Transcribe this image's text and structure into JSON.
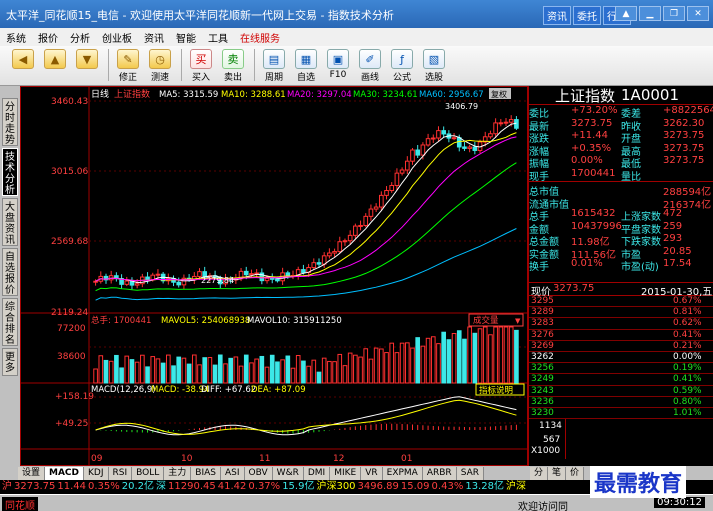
{
  "titlebar": {
    "title": "太平洋_同花顺15_电信 - 欢迎使用太平洋同花顺新一代网上交易 - 指数技术分析",
    "links": [
      "资讯",
      "委托",
      "行情"
    ],
    "win_buttons": [
      "▲",
      "▁",
      "❐",
      "✕"
    ]
  },
  "menubar": {
    "items": [
      "系统",
      "报价",
      "分析",
      "创业板",
      "资讯",
      "智能",
      "工具",
      "在线服务"
    ]
  },
  "toolbar": {
    "buttons": [
      {
        "label": "",
        "icon": "arrow-left-icon"
      },
      {
        "label": "",
        "icon": "arrow-up-icon"
      },
      {
        "label": "",
        "icon": "arrow-down-icon"
      },
      {
        "label": "修正",
        "icon": "edit-icon"
      },
      {
        "label": "测速",
        "icon": "speed-icon"
      },
      {
        "label": "买入",
        "icon": "buy-icon",
        "glyph": "买"
      },
      {
        "label": "卖出",
        "icon": "sell-icon",
        "glyph": "卖"
      },
      {
        "label": "周期",
        "icon": "period-icon"
      },
      {
        "label": "自选",
        "icon": "favorites-icon"
      },
      {
        "label": "F10",
        "icon": "f10-icon"
      },
      {
        "label": "画线",
        "icon": "draw-line-icon"
      },
      {
        "label": "公式",
        "icon": "formula-icon"
      },
      {
        "label": "选股",
        "icon": "stock-select-icon"
      }
    ]
  },
  "left_tabs": [
    "分时走势",
    "技术分析",
    "大盘资讯",
    "自选报价",
    "综合排名",
    "更多"
  ],
  "chart": {
    "period_label": "日线",
    "index_name": "上证指数",
    "ma": [
      {
        "label": "MA5: 3315.59",
        "color": "#ffffff"
      },
      {
        "label": "MA10: 3288.61",
        "color": "#ffff00"
      },
      {
        "label": "MA20: 3297.04",
        "color": "#ff00ff"
      },
      {
        "label": "MA30: 3234.61",
        "color": "#00ff00"
      },
      {
        "label": "MA60: 2956.67",
        "color": "#00bfff"
      }
    ],
    "price_axis": [
      "3460.43",
      "3015.06",
      "2569.68",
      "2119.24"
    ],
    "high_mark": "3406.79",
    "low_mark": "2279.84",
    "volume_legend": {
      "total": "总手: 1700441",
      "mavol5": "MAVOL5: 254068938",
      "mavol10": "MAVOL10: 315911250"
    },
    "volume_axis": [
      "77200",
      "38600"
    ],
    "volume_select": "成交量",
    "macd_legend": {
      "name": "MACD(12,26,9)",
      "macd": "MACD: -38.94",
      "diff": "DIFF: +67.62",
      "dea": "DEA: +87.09"
    },
    "macd_axis": [
      "+158.19",
      "+49.25"
    ],
    "macd_button": "指标说明",
    "x_labels": [
      "09",
      "10",
      "11",
      "12",
      "01"
    ],
    "corner_label": "复权"
  },
  "quote": {
    "name": "上证指数",
    "code": "1A0001",
    "rows": [
      {
        "l": "委比",
        "v1": "+73.20%",
        "l2": "委差",
        "v2": "+8822564"
      },
      {
        "l": "最新",
        "v1": "3273.75",
        "l2": "昨收",
        "v2": "3262.30"
      },
      {
        "l": "涨跌",
        "v1": "+11.44",
        "l2": "开盘",
        "v2": "3273.75"
      },
      {
        "l": "涨幅",
        "v1": "+0.35%",
        "l2": "最高",
        "v2": "3273.75"
      },
      {
        "l": "振幅",
        "v1": "0.00%",
        "l2": "最低",
        "v2": "3273.75"
      },
      {
        "l": "现手",
        "v1": "1700441",
        "l2": "量比",
        "v2": ""
      }
    ],
    "rows2": [
      {
        "l": "总市值",
        "v1": "",
        "l2": "",
        "v2": "288594亿"
      },
      {
        "l": "流通市值",
        "v1": "",
        "l2": "",
        "v2": "216374亿"
      },
      {
        "l": "总手",
        "v1": "1615432",
        "l2": "上涨家数",
        "v2": "472"
      },
      {
        "l": "金额",
        "v1": "10437996",
        "l2": "平盘家数",
        "v2": "259"
      },
      {
        "l": "总金额",
        "v1": "11.98亿",
        "l2": "下跌家数",
        "v2": "293"
      },
      {
        "l": "实金额",
        "v1": "111.56亿",
        "l2": "市盈",
        "v2": "20.85"
      },
      {
        "l": "换手",
        "v1": "0.01%",
        "l2": "市盈(动)",
        "v2": "17.54"
      }
    ],
    "tick_header": {
      "label": "现价",
      "price": "3273.75",
      "date": "2015-01-30,五"
    },
    "ticks": [
      {
        "price": "3295",
        "pct": "0.67%"
      },
      {
        "price": "3289",
        "pct": "0.81%"
      },
      {
        "price": "3283",
        "pct": "0.62%"
      },
      {
        "price": "3276",
        "pct": "0.41%"
      },
      {
        "price": "3269",
        "pct": "0.21%"
      },
      {
        "price": "3262",
        "pct": "0.00%"
      },
      {
        "price": "3256",
        "pct": "0.19%"
      },
      {
        "price": "3249",
        "pct": "0.41%"
      },
      {
        "price": "3243",
        "pct": "0.59%"
      },
      {
        "price": "3236",
        "pct": "0.80%"
      },
      {
        "price": "3230",
        "pct": "1.01%"
      }
    ],
    "vol_axis": [
      "1134",
      "567",
      "X1000"
    ]
  },
  "bottom_tabs": [
    "设置",
    "MACD",
    "KDJ",
    "RSI",
    "BOLL",
    "主力",
    "BIAS",
    "ASI",
    "OBV",
    "W&R",
    "DMI",
    "MIKE",
    "VR",
    "EXPMA",
    "ARBR",
    "SAR"
  ],
  "bottom_tabs_active": "MACD",
  "right_tabs": [
    "分",
    "笔",
    "价"
  ],
  "ticker": [
    {
      "t": "沪",
      "c": "#ff4040"
    },
    {
      "t": "3273.75",
      "c": "#ff4040"
    },
    {
      "t": "11.44",
      "c": "#ff4040"
    },
    {
      "t": "0.35%",
      "c": "#ff4040"
    },
    {
      "t": "20.2亿",
      "c": "#3ce8e8"
    },
    {
      "t": "深",
      "c": "#3ce8e8"
    },
    {
      "t": "11290.45",
      "c": "#ff4040"
    },
    {
      "t": "41.42",
      "c": "#ff4040"
    },
    {
      "t": "0.37%",
      "c": "#ff4040"
    },
    {
      "t": "15.9亿",
      "c": "#3ce8e8"
    },
    {
      "t": "沪深300",
      "c": "#ffff00"
    },
    {
      "t": "3496.89",
      "c": "#ff4040"
    },
    {
      "t": "15.09",
      "c": "#ff4040"
    },
    {
      "t": "0.43%",
      "c": "#ff4040"
    },
    {
      "t": "13.28亿",
      "c": "#3ce8e8"
    },
    {
      "t": "沪深",
      "c": "#ffff00"
    }
  ],
  "status": {
    "left": "同花顺",
    "mid": "欢迎访问同",
    "time": "09:30:12"
  },
  "watermark": "最需教育"
}
